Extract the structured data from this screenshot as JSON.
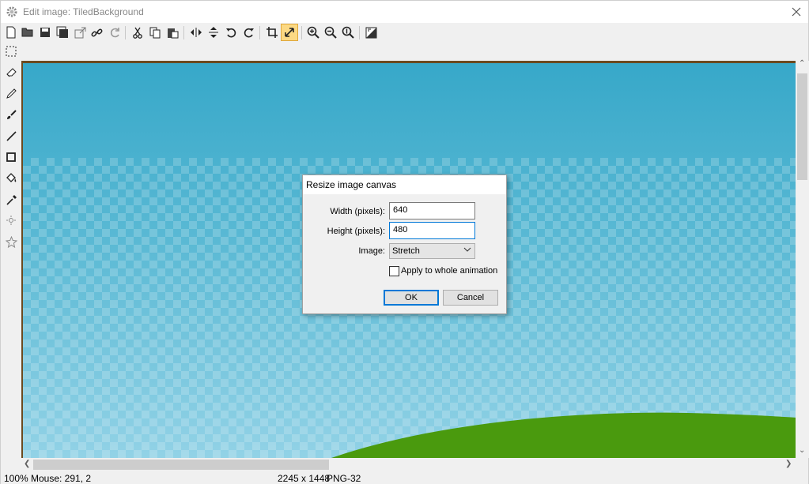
{
  "window": {
    "title": "Edit image: TiledBackground"
  },
  "toolbar": {
    "icons": [
      "new-file-icon",
      "open-folder-icon",
      "save-icon",
      "save-copy-icon",
      "export-icon",
      "link-icon",
      "refresh-icon",
      "cut-icon",
      "copy-icon",
      "paste-icon",
      "flip-horizontal-icon",
      "flip-vertical-icon",
      "rotate-left-icon",
      "rotate-right-icon",
      "crop-icon",
      "resize-icon",
      "zoom-in-icon",
      "zoom-out-icon",
      "zoom-reset-icon",
      "image-properties-icon"
    ],
    "active": "resize-icon"
  },
  "tools": [
    "selection-icon",
    "eraser-icon",
    "pencil-icon",
    "brush-icon",
    "line-icon",
    "rectangle-icon",
    "fill-bucket-icon",
    "eyedropper-icon",
    "sparkle-icon",
    "star-icon"
  ],
  "dialog": {
    "title": "Resize image canvas",
    "width_label": "Width (pixels):",
    "width_value": "640",
    "height_label": "Height (pixels):",
    "height_value": "480",
    "image_label": "Image:",
    "image_option": "Stretch",
    "apply_label": "Apply to whole animation",
    "apply_checked": false,
    "ok_label": "OK",
    "cancel_label": "Cancel"
  },
  "status": {
    "zoom": "100%",
    "mouse": "Mouse: 291, 2",
    "size": "2245 x 1448",
    "format": "PNG-32"
  },
  "colors": {
    "sky_top": "#37a8c9",
    "sky_bottom": "#92d2e6",
    "hill": "#4a9a0e",
    "frame": "#6b4a20",
    "accent": "#0078d7"
  }
}
